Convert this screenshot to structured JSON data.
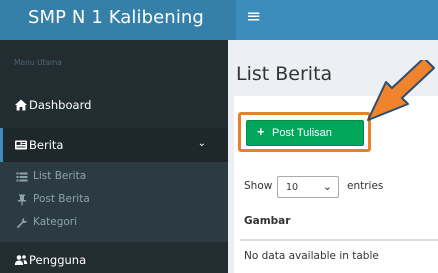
{
  "brand": {
    "title": "SMP N 1 Kalibening"
  },
  "topbar": {
    "menu_icon": "hamburger-icon"
  },
  "sidebar": {
    "header": "Menu Utama",
    "items": [
      {
        "label": "Dashboard",
        "icon": "home-icon"
      },
      {
        "label": "Berita",
        "icon": "newspaper-icon",
        "expanded": true,
        "children": [
          {
            "label": "List Berita",
            "icon": "list-icon"
          },
          {
            "label": "Post Berita",
            "icon": "pin-icon"
          },
          {
            "label": "Kategori",
            "icon": "wrench-icon"
          }
        ]
      },
      {
        "label": "Pengguna",
        "icon": "users-icon"
      }
    ]
  },
  "main": {
    "title": "List Berita",
    "post_button": "Post Tulisan",
    "show_label": "Show",
    "page_length": "10",
    "entries_label": "entries",
    "table": {
      "columns": [
        "Gambar"
      ],
      "empty_message": "No data available in table"
    }
  },
  "colors": {
    "accent": "#3c8dbc",
    "sidebar_bg": "#222d32",
    "button_green": "#00a65a",
    "annotation_orange": "#e8822a"
  }
}
